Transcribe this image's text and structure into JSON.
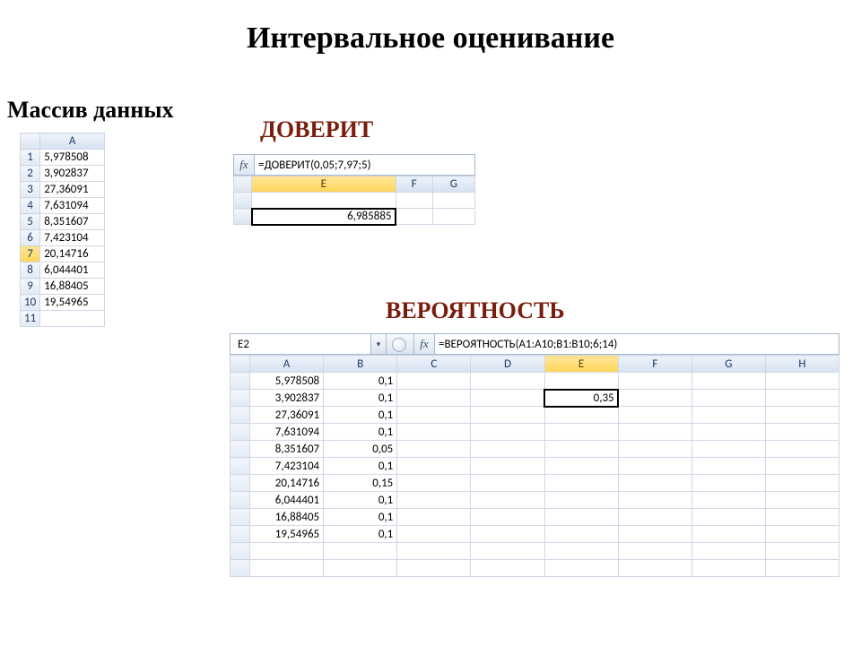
{
  "title": "Интервальное оценивание",
  "subtitle": "Массив данных",
  "labels": {
    "doverit": "ДОВЕРИТ",
    "probability": "ВЕРОЯТНОСТЬ"
  },
  "fx_glyph": "fx",
  "data_column_header": "A",
  "data_rows": [
    {
      "n": "1",
      "v": "5,978508"
    },
    {
      "n": "2",
      "v": "3,902837"
    },
    {
      "n": "3",
      "v": "27,36091"
    },
    {
      "n": "4",
      "v": "7,631094"
    },
    {
      "n": "5",
      "v": "8,351607"
    },
    {
      "n": "6",
      "v": "7,423104"
    },
    {
      "n": "7",
      "v": "20,14716"
    },
    {
      "n": "8",
      "v": "6,044401"
    },
    {
      "n": "9",
      "v": "16,88405"
    },
    {
      "n": "10",
      "v": "19,54965"
    },
    {
      "n": "11",
      "v": ""
    }
  ],
  "data_selected_row_index": 6,
  "doverit": {
    "formula": "=ДОВЕРИТ(0,05;7,97;5)",
    "columns": [
      "E",
      "F",
      "G"
    ],
    "result": "6,985885"
  },
  "prob": {
    "namebox": "E2",
    "formula": "=ВЕРОЯТНОСТЬ(A1:A10;B1:B10;6;14)",
    "columns": [
      "A",
      "B",
      "C",
      "D",
      "E",
      "F",
      "G",
      "H"
    ],
    "selected_col": "E",
    "result": "0,35",
    "rows": [
      {
        "a": "5,978508",
        "b": "0,1"
      },
      {
        "a": "3,902837",
        "b": "0,1"
      },
      {
        "a": "27,36091",
        "b": "0,1"
      },
      {
        "a": "7,631094",
        "b": "0,1"
      },
      {
        "a": "8,351607",
        "b": "0,05"
      },
      {
        "a": "7,423104",
        "b": "0,1"
      },
      {
        "a": "20,14716",
        "b": "0,15"
      },
      {
        "a": "6,044401",
        "b": "0,1"
      },
      {
        "a": "16,88405",
        "b": "0,1"
      },
      {
        "a": "19,54965",
        "b": "0,1"
      }
    ],
    "result_row_index": 1
  }
}
